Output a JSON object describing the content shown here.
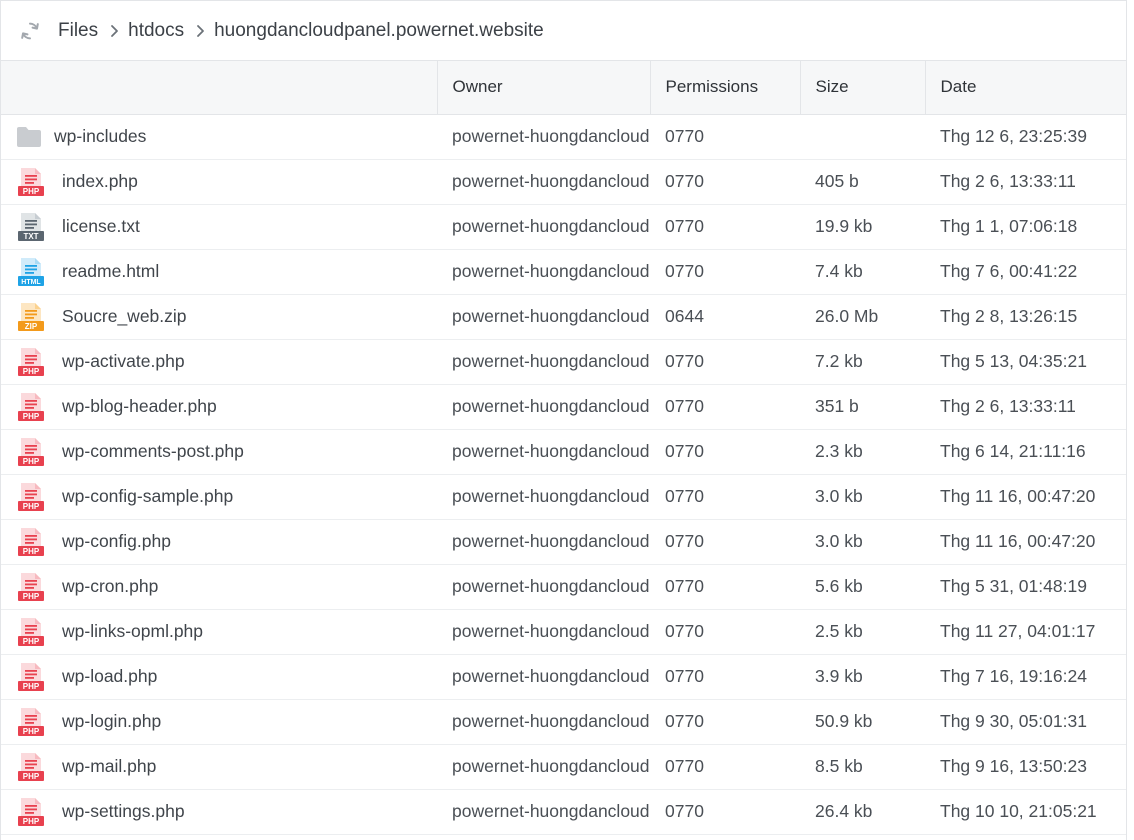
{
  "breadcrumb": {
    "items": [
      "Files",
      "htdocs",
      "huongdancloudpanel.powernet.website"
    ]
  },
  "table": {
    "headers": {
      "name": "",
      "owner": "Owner",
      "permissions": "Permissions",
      "size": "Size",
      "date": "Date"
    },
    "rows": [
      {
        "name": "wp-includes",
        "type": "folder",
        "owner": "powernet-huongdancloud",
        "perm": "0770",
        "size": "",
        "date": "Thg 12 6, 23:25:39"
      },
      {
        "name": "index.php",
        "type": "php",
        "owner": "powernet-huongdancloud",
        "perm": "0770",
        "size": "405 b",
        "date": "Thg 2 6, 13:33:11"
      },
      {
        "name": "license.txt",
        "type": "txt",
        "owner": "powernet-huongdancloud",
        "perm": "0770",
        "size": "19.9 kb",
        "date": "Thg 1 1, 07:06:18"
      },
      {
        "name": "readme.html",
        "type": "html",
        "owner": "powernet-huongdancloud",
        "perm": "0770",
        "size": "7.4 kb",
        "date": "Thg 7 6, 00:41:22"
      },
      {
        "name": "Soucre_web.zip",
        "type": "zip",
        "owner": "powernet-huongdancloud",
        "perm": "0644",
        "size": "26.0 Mb",
        "date": "Thg 2 8, 13:26:15"
      },
      {
        "name": "wp-activate.php",
        "type": "php",
        "owner": "powernet-huongdancloud",
        "perm": "0770",
        "size": "7.2 kb",
        "date": "Thg 5 13, 04:35:21"
      },
      {
        "name": "wp-blog-header.php",
        "type": "php",
        "owner": "powernet-huongdancloud",
        "perm": "0770",
        "size": "351 b",
        "date": "Thg 2 6, 13:33:11"
      },
      {
        "name": "wp-comments-post.php",
        "type": "php",
        "owner": "powernet-huongdancloud",
        "perm": "0770",
        "size": "2.3 kb",
        "date": "Thg 6 14, 21:11:16"
      },
      {
        "name": "wp-config-sample.php",
        "type": "php",
        "owner": "powernet-huongdancloud",
        "perm": "0770",
        "size": "3.0 kb",
        "date": "Thg 11 16, 00:47:20"
      },
      {
        "name": "wp-config.php",
        "type": "php",
        "owner": "powernet-huongdancloud",
        "perm": "0770",
        "size": "3.0 kb",
        "date": "Thg 11 16, 00:47:20"
      },
      {
        "name": "wp-cron.php",
        "type": "php",
        "owner": "powernet-huongdancloud",
        "perm": "0770",
        "size": "5.6 kb",
        "date": "Thg 5 31, 01:48:19"
      },
      {
        "name": "wp-links-opml.php",
        "type": "php",
        "owner": "powernet-huongdancloud",
        "perm": "0770",
        "size": "2.5 kb",
        "date": "Thg 11 27, 04:01:17"
      },
      {
        "name": "wp-load.php",
        "type": "php",
        "owner": "powernet-huongdancloud",
        "perm": "0770",
        "size": "3.9 kb",
        "date": "Thg 7 16, 19:16:24"
      },
      {
        "name": "wp-login.php",
        "type": "php",
        "owner": "powernet-huongdancloud",
        "perm": "0770",
        "size": "50.9 kb",
        "date": "Thg 9 30, 05:01:31"
      },
      {
        "name": "wp-mail.php",
        "type": "php",
        "owner": "powernet-huongdancloud",
        "perm": "0770",
        "size": "8.5 kb",
        "date": "Thg 9 16, 13:50:23"
      },
      {
        "name": "wp-settings.php",
        "type": "php",
        "owner": "powernet-huongdancloud",
        "perm": "0770",
        "size": "26.4 kb",
        "date": "Thg 10 10, 21:05:21"
      }
    ]
  },
  "icons": {
    "refresh": "refresh-icon",
    "chevron": "chevron-right-icon",
    "folder": "folder-icon",
    "php": "php-file-icon",
    "txt": "txt-file-icon",
    "html": "html-file-icon",
    "zip": "zip-file-icon"
  },
  "file_badges": {
    "php": "PHP",
    "txt": "TXT",
    "html": "HTML",
    "zip": "ZIP"
  },
  "colors": {
    "php": "#e8414f",
    "php_light": "#f7b9bf",
    "txt": "#5b6670",
    "txt_light": "#c7cdd2",
    "html": "#1fa3e6",
    "html_light": "#a9dbf5",
    "zip": "#f39a1b",
    "zip_light": "#fbd28f",
    "folder": "#c9ccd0"
  }
}
